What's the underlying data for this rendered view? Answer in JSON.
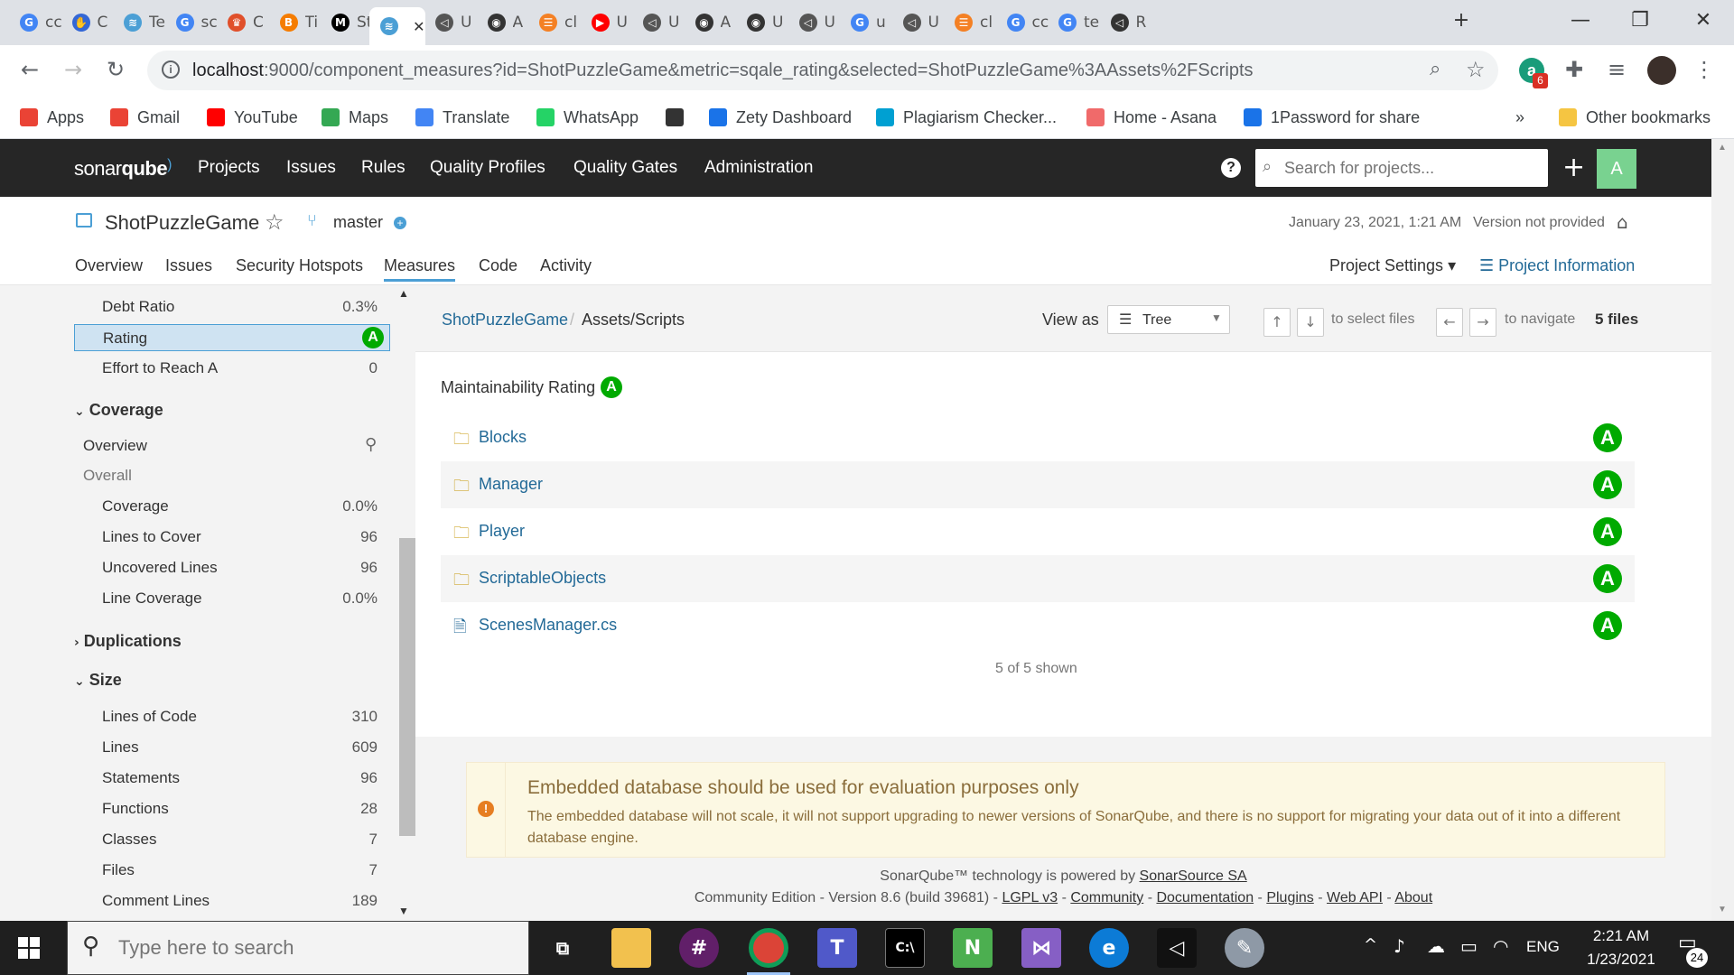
{
  "browser": {
    "tabs": [
      {
        "letter": "G",
        "title": "cc",
        "color": "#4285f4"
      },
      {
        "letter": "✋",
        "title": "C",
        "color": "#3367d6"
      },
      {
        "letter": "≋",
        "title": "Te",
        "color": "#4b9fd5"
      },
      {
        "letter": "G",
        "title": "sc",
        "color": "#4285f4"
      },
      {
        "letter": "♛",
        "title": "C",
        "color": "#e04f2a"
      },
      {
        "letter": "B",
        "title": "Ti",
        "color": "#f57c00"
      },
      {
        "letter": "M",
        "title": "St",
        "color": "#000000"
      },
      {
        "letter": "≋",
        "title": "",
        "color": "#4b9fd5",
        "active": true
      },
      {
        "letter": "◁",
        "title": "U",
        "color": "#555555"
      },
      {
        "letter": "◉",
        "title": "A",
        "color": "#333333"
      },
      {
        "letter": "☰",
        "title": "cl",
        "color": "#f48024"
      },
      {
        "letter": "▶",
        "title": "U",
        "color": "#ff0000"
      },
      {
        "letter": "◁",
        "title": "U",
        "color": "#555555"
      },
      {
        "letter": "◉",
        "title": "A",
        "color": "#333333"
      },
      {
        "letter": "◉",
        "title": "U",
        "color": "#333333"
      },
      {
        "letter": "◁",
        "title": "U",
        "color": "#555555"
      },
      {
        "letter": "G",
        "title": "u",
        "color": "#4285f4"
      },
      {
        "letter": "◁",
        "title": "U",
        "color": "#555555"
      },
      {
        "letter": "☰",
        "title": "cl",
        "color": "#f48024"
      },
      {
        "letter": "G",
        "title": "cc",
        "color": "#4285f4"
      },
      {
        "letter": "G",
        "title": "te",
        "color": "#4285f4"
      },
      {
        "letter": "◁",
        "title": "R",
        "color": "#333333"
      }
    ],
    "new_tab": "+",
    "minimize": "—",
    "maximize": "❐",
    "close": "✕",
    "url_host": "localhost",
    "url_rest": ":9000/component_measures?id=ShotPuzzleGame&metric=sqale_rating&selected=ShotPuzzleGame%3AAssets%2FScripts",
    "extension_badge": "6",
    "bookmarks": [
      {
        "label": "Apps",
        "icon": "apps-grid-icon",
        "color": "#ea4335"
      },
      {
        "label": "Gmail",
        "icon": "gmail-icon",
        "color": "#ea4335"
      },
      {
        "label": "YouTube",
        "icon": "youtube-icon",
        "color": "#ff0000"
      },
      {
        "label": "Maps",
        "icon": "maps-pin-icon",
        "color": "#34a853"
      },
      {
        "label": "Translate",
        "icon": "translate-icon",
        "color": "#4285f4"
      },
      {
        "label": "WhatsApp",
        "icon": "whatsapp-icon",
        "color": "#25d366"
      },
      {
        "label": "",
        "icon": "globe-icon",
        "color": "#333333"
      },
      {
        "label": "Zety Dashboard",
        "icon": "zety-icon",
        "color": "#1a73e8"
      },
      {
        "label": "Plagiarism Checker...",
        "icon": "plagiarism-icon",
        "color": "#00a0d2"
      },
      {
        "label": "Home - Asana",
        "icon": "asana-icon",
        "color": "#f06a6a"
      },
      {
        "label": "1Password for share",
        "icon": "1password-icon",
        "color": "#1a73e8"
      }
    ],
    "more_bookmarks": "»",
    "other_bookmarks": "Other bookmarks"
  },
  "sonar_nav": {
    "logo_a": "sonar",
    "logo_b": "qube",
    "links": [
      "Projects",
      "Issues",
      "Rules",
      "Quality Profiles",
      "Quality Gates",
      "Administration"
    ],
    "help": "?",
    "search_placeholder": "Search for projects...",
    "plus": "+",
    "avatar": "A"
  },
  "project": {
    "name": "ShotPuzzleGame",
    "branch": "master",
    "date": "January 23, 2021, 1:21 AM",
    "version": "Version not provided",
    "tabs": [
      "Overview",
      "Issues",
      "Security Hotspots",
      "Measures",
      "Code",
      "Activity"
    ],
    "active_tab": "Measures",
    "settings": "Project Settings",
    "info": "Project Information"
  },
  "sidebar": {
    "top_rows": [
      {
        "label": "Debt Ratio",
        "value": "0.3%"
      },
      {
        "label": "Rating",
        "value": "A",
        "selected": true
      },
      {
        "label": "Effort to Reach A",
        "value": "0"
      }
    ],
    "coverage": {
      "title": "Coverage",
      "overview": "Overview",
      "overall": "Overall",
      "rows": [
        {
          "label": "Coverage",
          "value": "0.0%"
        },
        {
          "label": "Lines to Cover",
          "value": "96"
        },
        {
          "label": "Uncovered Lines",
          "value": "96"
        },
        {
          "label": "Line Coverage",
          "value": "0.0%"
        }
      ]
    },
    "duplications": "Duplications",
    "size": {
      "title": "Size",
      "rows": [
        {
          "label": "Lines of Code",
          "value": "310"
        },
        {
          "label": "Lines",
          "value": "609"
        },
        {
          "label": "Statements",
          "value": "96"
        },
        {
          "label": "Functions",
          "value": "28"
        },
        {
          "label": "Classes",
          "value": "7"
        },
        {
          "label": "Files",
          "value": "7"
        },
        {
          "label": "Comment Lines",
          "value": "189"
        }
      ]
    }
  },
  "main": {
    "breadcrumb_root": "ShotPuzzleGame",
    "breadcrumb_sep": "/",
    "breadcrumb_current": "Assets/Scripts",
    "view_as_label": "View as",
    "view_as_value": "Tree",
    "select_files": "to select files",
    "navigate": "to navigate",
    "files_count": "5 files",
    "metric_title": "Maintainability Rating",
    "metric_value": "A",
    "items": [
      {
        "name": "Blocks",
        "type": "folder",
        "rating": "A"
      },
      {
        "name": "Manager",
        "type": "folder",
        "rating": "A"
      },
      {
        "name": "Player",
        "type": "folder",
        "rating": "A"
      },
      {
        "name": "ScriptableObjects",
        "type": "folder",
        "rating": "A"
      },
      {
        "name": "ScenesManager.cs",
        "type": "file",
        "rating": "A"
      }
    ],
    "shown": "5 of 5 shown",
    "warning_title": "Embedded database should be used for evaluation purposes only",
    "warning_text": "The embedded database will not scale, it will not support upgrading to newer versions of SonarQube, and there is no support for migrating your data out of it into a different database engine.",
    "footer_powered": "SonarQube™ technology is powered by ",
    "footer_company": "SonarSource SA",
    "footer_edition": "Community Edition - Version 8.6 (build 39681) - ",
    "footer_links": [
      "LGPL v3",
      "Community",
      "Documentation",
      "Plugins",
      "Web API",
      "About"
    ]
  },
  "taskbar": {
    "search_placeholder": "Type here to search",
    "lang": "ENG",
    "time": "2:21 AM",
    "date": "1/23/2021",
    "notifications": "24"
  }
}
